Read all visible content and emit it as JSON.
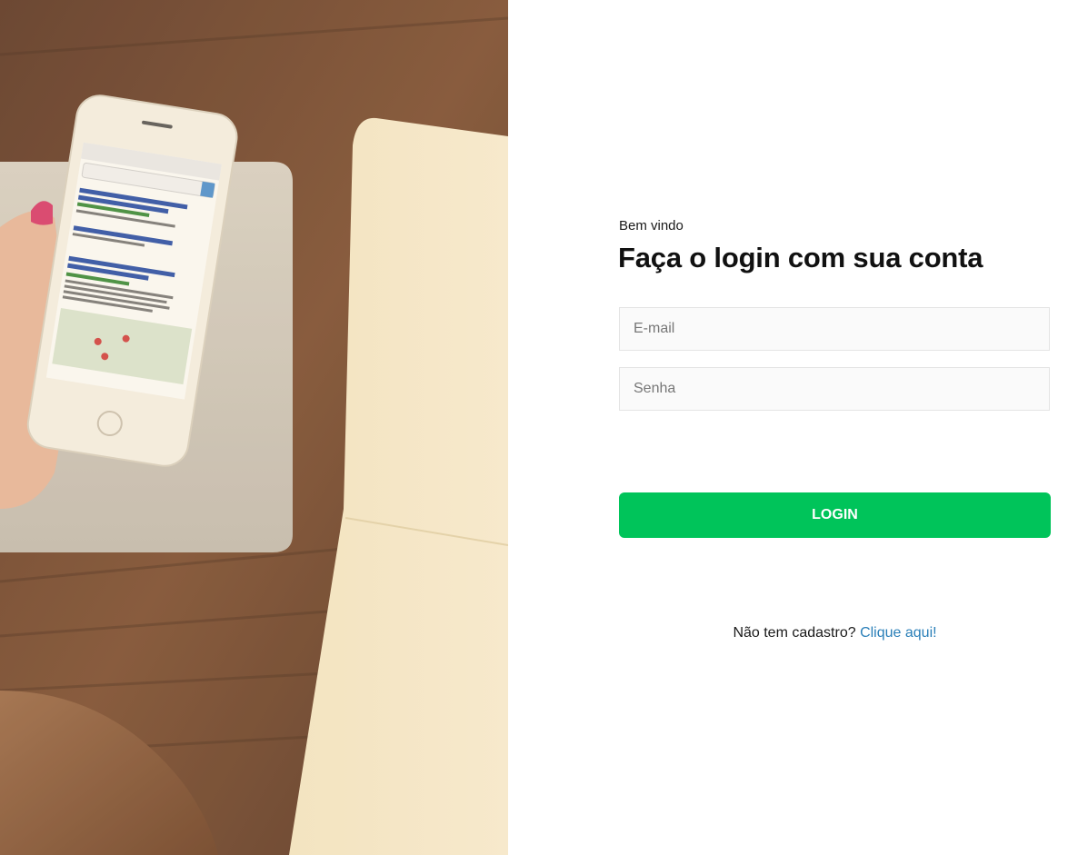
{
  "hero": {
    "image_description_icon": "desk-photo-image"
  },
  "form": {
    "welcome": "Bem vindo",
    "title": "Faça o login com sua conta",
    "email_placeholder": "E-mail",
    "password_placeholder": "Senha",
    "login_label": "LOGIN",
    "signup_prompt": "Não tem cadastro?",
    "signup_link": "Clique aqui!"
  },
  "colors": {
    "accent": "#00c45a",
    "link": "#2a7fb8"
  }
}
